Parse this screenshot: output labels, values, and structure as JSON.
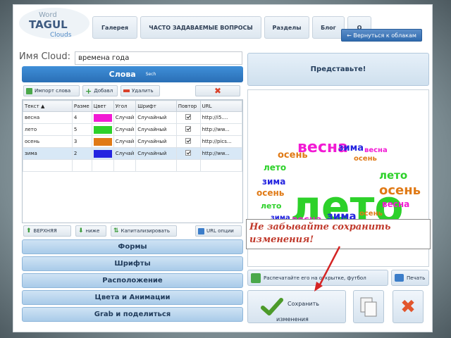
{
  "nav": {
    "logo_words": [
      "Word",
      "TAGUL",
      "Clouds"
    ],
    "items": [
      "Галерея",
      "ЧАСТО ЗАДАВАЕМЫЕ ВОПРОСЫ",
      "Разделы",
      "Блог",
      "О"
    ],
    "back_label": "← Вернуться к облакам"
  },
  "editor": {
    "name_label": "Имя Cloud:",
    "name_value": "времена года",
    "words_title": "Слова",
    "words_subtitle": "Sech",
    "toolbar": {
      "import_label": "Импорт слова",
      "add_label": "Добавл",
      "delete_label": "Удалить"
    },
    "table": {
      "headers": [
        "Текст ▲",
        "Разме",
        "Цвет",
        "Угол",
        "Шрифт",
        "Повтор",
        "URL"
      ],
      "rows": [
        {
          "text": "весна",
          "size": "4",
          "color": "#f21ad4",
          "angle": "Случай",
          "font": "Случайный",
          "url": "http://i5...."
        },
        {
          "text": "лето",
          "size": "5",
          "color": "#2dd12a",
          "angle": "Случай",
          "font": "Случайный",
          "url": "http://ww..."
        },
        {
          "text": "осень",
          "size": "3",
          "color": "#e07a16",
          "angle": "Случай",
          "font": "Случайный",
          "url": "http://pics..."
        },
        {
          "text": "зима",
          "size": "2",
          "color": "#2424e0",
          "angle": "Случай",
          "font": "Случайный",
          "url": "http://ww..."
        }
      ]
    },
    "bottom_toolbar": [
      "ВЕРХНЯЯ",
      "нижe",
      "Капитализировать",
      "URL опции"
    ],
    "sections": [
      "Формы",
      "Шрифты",
      "Расположение",
      "Цвета и Анимации",
      "Grab и поделиться"
    ]
  },
  "preview": {
    "title": "Представьте!",
    "print_label": "Распечатайте его на открытке, футбол",
    "print_button": "Печать",
    "save_label_1": "Сохранить",
    "save_label_2": "изменения"
  },
  "callout": "Не забывайте сохранить изменения!",
  "colors": {
    "pink": "#f21ad4",
    "green": "#2dd12a",
    "orange": "#e07a16",
    "blue": "#2424e0",
    "accent": "#2a6fb6"
  }
}
